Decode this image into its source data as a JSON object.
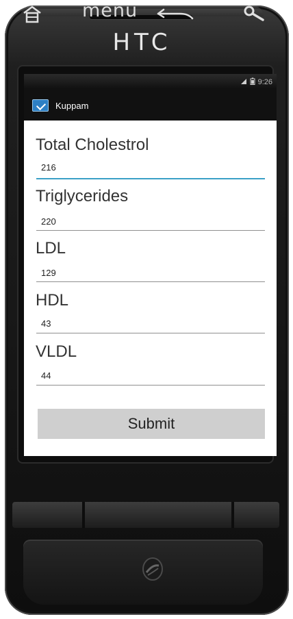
{
  "device": {
    "brand": "HTC",
    "nav_menu_label": "menu"
  },
  "status_bar": {
    "time": "9:26",
    "icons": [
      "signal-icon",
      "battery-icon"
    ]
  },
  "app": {
    "title": "Kuppam",
    "icon": "app-icon"
  },
  "form": {
    "fields": [
      {
        "label": "Total Cholestrol",
        "value": "216"
      },
      {
        "label": "Triglycerides",
        "value": "220"
      },
      {
        "label": "LDL",
        "value": "129"
      },
      {
        "label": "HDL",
        "value": "43"
      },
      {
        "label": "VLDL",
        "value": "44"
      }
    ],
    "submit_label": "Submit"
  },
  "colors": {
    "accent_underline": "#3aa0c6",
    "button_bg": "#cfcfcf",
    "app_icon": "#2d7fc4"
  }
}
